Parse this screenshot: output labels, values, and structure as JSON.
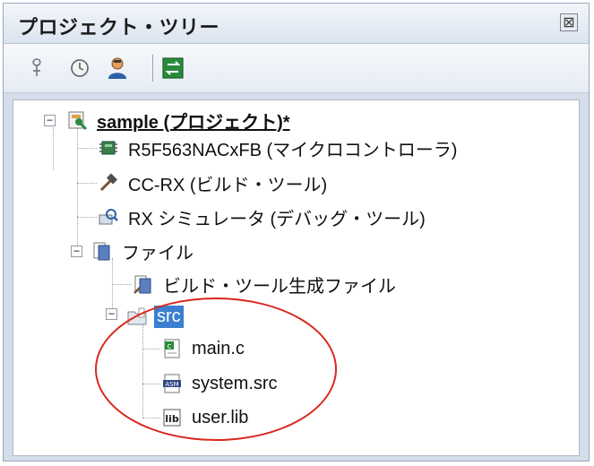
{
  "panel": {
    "title": "プロジェクト・ツリー",
    "close_glyph": "⊠"
  },
  "toolbar": {
    "buttons": [
      {
        "name": "pin-icon"
      },
      {
        "name": "properties-icon"
      },
      {
        "name": "user-icon"
      },
      {
        "name": "refresh-icon"
      }
    ]
  },
  "tree": {
    "project": {
      "label": "sample (プロジェクト)*",
      "expanded": true
    },
    "microcontroller": {
      "label": "R5F563NACxFB (マイクロコントローラ)"
    },
    "build_tool": {
      "label": "CC-RX (ビルド・ツール)"
    },
    "debug_tool": {
      "label": "RX シミュレータ (デバッグ・ツール)"
    },
    "files": {
      "label": "ファイル",
      "expanded": true
    },
    "build_generated": {
      "label": "ビルド・ツール生成ファイル"
    },
    "src_folder": {
      "label": "src",
      "selected": true,
      "expanded": true
    },
    "src_files": [
      {
        "label": "main.c",
        "icon": "c-file-icon",
        "badge": "c"
      },
      {
        "label": "system.src",
        "icon": "asm-file-icon",
        "badge": "ASM"
      },
      {
        "label": "user.lib",
        "icon": "lib-file-icon",
        "badge": "lib"
      }
    ]
  },
  "colors": {
    "selection": "#3b7fd0",
    "annotation": "#d9281e"
  }
}
